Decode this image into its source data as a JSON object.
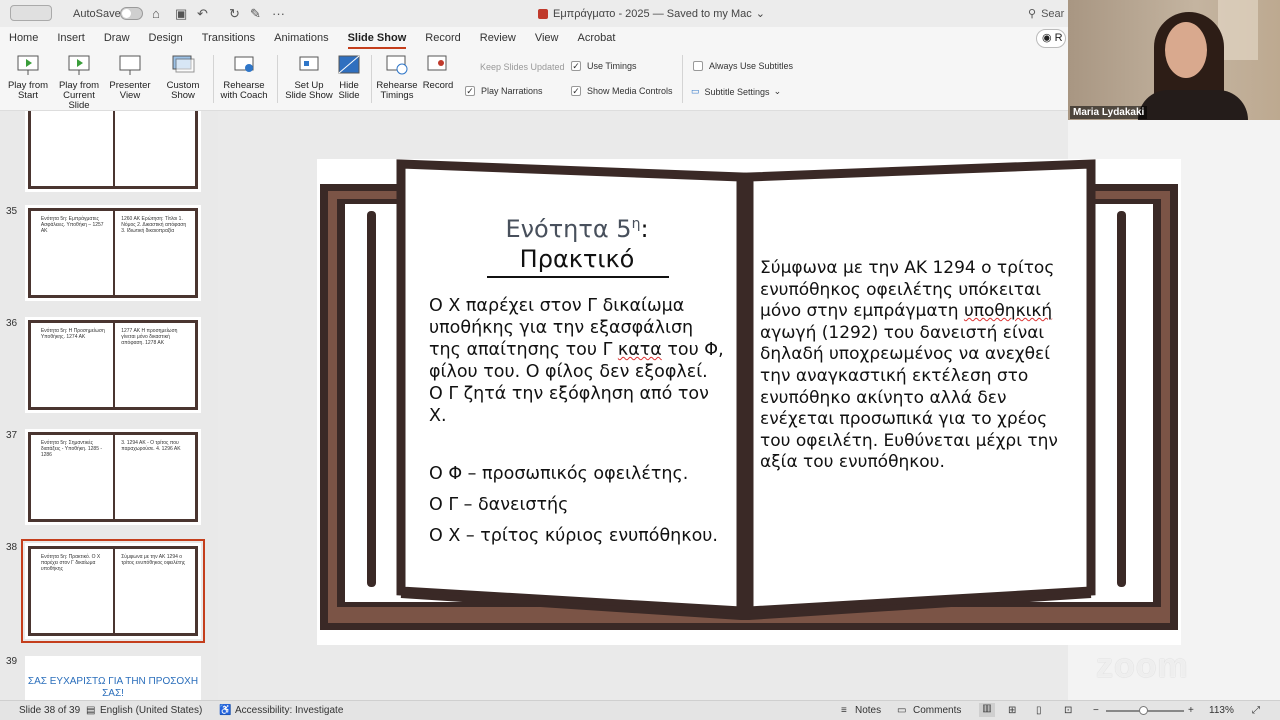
{
  "titlebar": {
    "autosave": "AutoSave",
    "doc_title": "Εμπράγματο - 2025 — Saved to my Mac",
    "search": "Sear"
  },
  "tabs": [
    "Home",
    "Insert",
    "Draw",
    "Design",
    "Transitions",
    "Animations",
    "Slide Show",
    "Record",
    "Review",
    "View",
    "Acrobat"
  ],
  "record_button": "R",
  "ribbon": {
    "play_from_start": [
      "Play from",
      "Start"
    ],
    "play_current": [
      "Play from",
      "Current Slide"
    ],
    "presenter_view": [
      "Presenter",
      "View"
    ],
    "custom_show": [
      "Custom",
      "Show"
    ],
    "rehearse_coach": [
      "Rehearse",
      "with Coach"
    ],
    "setup_show": [
      "Set Up",
      "Slide Show"
    ],
    "hide_slide": [
      "Hide",
      "Slide"
    ],
    "rehearse_timings": [
      "Rehearse",
      "Timings"
    ],
    "record": "Record",
    "keep_slides_updated": "Keep Slides Updated",
    "use_timings": "Use Timings",
    "play_narrations": "Play Narrations",
    "show_media_controls": "Show Media Controls",
    "always_use_subtitles": "Always Use Subtitles",
    "subtitle_settings": "Subtitle Settings"
  },
  "webcam": {
    "name": "Maria Lydakaki"
  },
  "thumbnails": [
    {
      "num": "35",
      "left": "Ενότητα 5η: Εμπράγματες Ασφάλειες. Υποθήκη – 1257 ΑΚ",
      "right": "1260 ΑΚ Ερώτηση: Τίτλοι 1. Νόμος 2. Δικαστική απόφαση 3. Ιδιωτική δικαιοπραξία"
    },
    {
      "num": "36",
      "left": "Ενότητα 5η: Η Προσημείωση Υποθήκης. 1274 ΑΚ",
      "right": "1277 ΑΚ Η προσημείωση γίνεται μόνο δικαστική απόφαση. 1278 ΑΚ"
    },
    {
      "num": "37",
      "left": "Ενότητα 5η: Σημαντικές διατάξεις - Υποθήκη. 1285 - 1286",
      "right": "3. 1294 ΑΚ - Ο τρίτος που παραχωρούσε. 4. 1296 ΑΚ"
    },
    {
      "num": "38",
      "left": "Ενότητα 5η: Πρακτικό. Ο Χ παρέχει στον Γ δικαίωμα υποθήκης",
      "right": "Σύμφωνα με την ΑΚ 1294 ο τρίτος ενυπόθηκος οφειλέτης"
    }
  ],
  "thumb_last": {
    "num": "39",
    "text": "ΣΑΣ ΕΥΧΑΡΙΣΤΩ ΓΙΑ ΤΗΝ ΠΡΟΣΟΧΗ ΣΑΣ!"
  },
  "slide": {
    "title_line1": "Ενότητα 5",
    "title_sup": "η",
    "title_colon": ":",
    "title_line2": "Πρακτικό",
    "left_par_1": "Ο Χ παρέχει στον Γ δικαίωμα υποθήκης για την εξασφάλιση της απαίτησης του Γ ",
    "left_par_kata": "κατα",
    "left_par_2": " του Φ, φίλου του. Ο φίλος δεν εξοφλεί. Ο Γ ζητά την εξόφληση από τον Χ.",
    "list": [
      "Ο Φ – προσωπικός οφειλέτης.",
      "Ο Γ – δανειστής",
      "Ο Χ – τρίτος κύριος ενυπόθηκου."
    ],
    "right_1": "Σύμφωνα με την ΑΚ 1294 ο τρίτος ενυπόθηκος οφειλέτης υπόκειται μόνο στην εμπράγματη ",
    "right_uw": "υποθηκική",
    "right_2": " αγωγή (1292) του δανειστή είναι δηλαδή υποχρεωμένος να ανεχθεί την αναγκαστική εκτέλεση στο ενυπόθηκο ακίνητο αλλά δεν ενέχεται προσωπικά για το χρέος του οφειλέτη. Ευθύνεται μέχρι την αξία του ενυπόθηκου."
  },
  "zoom_watermark": "zoom",
  "status": {
    "slide": "Slide 38 of 39",
    "language": "English (United States)",
    "accessibility": "Accessibility: Investigate",
    "notes": "Notes",
    "comments": "Comments",
    "zoom": "113%"
  },
  "colors": {
    "accent": "#c43e1c",
    "book_dark": "#3a2926",
    "book_brown": "#7b5446"
  }
}
